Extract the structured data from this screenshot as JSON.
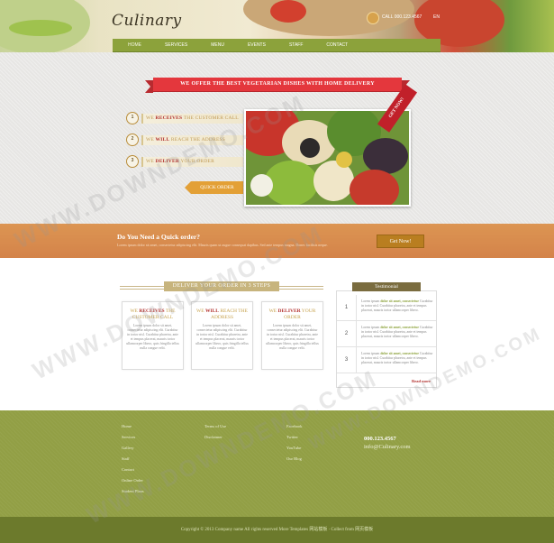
{
  "header": {
    "logo": "Culinary",
    "phone": "CALL 000.123.4567",
    "lang": "EN",
    "nav": [
      "HOME",
      "SERVICES",
      "MENU",
      "EVENTS",
      "STAFF",
      "CONTACT"
    ]
  },
  "hero": {
    "ribbon": "WE OFFER THE BEST VEGETARIAN DISHES WITH HOME DELIVERY",
    "steps": [
      {
        "num": "1",
        "pre": "WE ",
        "em": "RECEIVES",
        "post": " THE CUSTOMER CALL"
      },
      {
        "num": "2",
        "pre": "WE ",
        "em": "WILL",
        "post": " REACH THE ADDRESS"
      },
      {
        "num": "3",
        "pre": "WE ",
        "em": "DELIVER",
        "post": " YOUR ORDER"
      }
    ],
    "quick_order": "QUICK ORDER",
    "badge": "GET NOW!"
  },
  "band": {
    "title": "Do You Need a Quick order?",
    "subtitle": "Lorem ipsum dolor sit amet, consectetur adipiscing elit. Mauris quam ut augue consequat dapibus. Sed ante tempus magna. Donec facilisis neque.",
    "button": "Get Now!"
  },
  "deliver": {
    "title": "DELIVER YOUR ORDER IN 3 STEPS",
    "cards": [
      {
        "pre": "WE ",
        "em": "RECEIVES",
        "post": " THE CUSTOMER CALL",
        "body": "Lorem ipsum dolor sit amet, consectetur adipiscing elit. Curabitur in tortor nisl. Curabitur pharetra, ante et tempus placerat, mauris tortor ullamcorper libero, quis fringilla tellus nulla congue velit."
      },
      {
        "pre": "WE ",
        "em": "WILL",
        "post": " REACH THE ADDRESS",
        "body": "Lorem ipsum dolor sit amet, consectetur adipiscing elit. Curabitur in tortor nisl. Curabitur pharetra, ante et tempus placerat, mauris tortor ullamcorper libero, quis fringilla tellus nulla congue velit."
      },
      {
        "pre": "WE ",
        "em": "DELIVER",
        "post": " YOUR ORDER",
        "body": "Lorem ipsum dolor sit amet, consectetur adipiscing elit. Curabitur in tortor nisl. Curabitur pharetra, ante et tempus placerat, mauris tortor ullamcorper libero, quis fringilla tellus nulla congue velit."
      }
    ]
  },
  "testimonial": {
    "title": "Testimonial",
    "rows": [
      {
        "num": "1",
        "lead": "Lorem ipsum ",
        "em": "dolor sit amet, consectetur",
        "rest": " Curabitur in tortor nisl. Curabitur pharetra, ante et tempus placerat, mauris tortor ullamcorper libero."
      },
      {
        "num": "2",
        "lead": "Lorem ipsum ",
        "em": "dolor sit amet, consectetur",
        "rest": " Curabitur in tortor nisl. Curabitur pharetra, ante et tempus placerat, mauris tortor ullamcorper libero."
      },
      {
        "num": "3",
        "lead": "Lorem ipsum ",
        "em": "dolor sit amet, consectetur",
        "rest": " Curabitur in tortor nisl. Curabitur pharetra, ante et tempus placerat, mauris tortor ullamcorper libero."
      }
    ],
    "read_more": "Read more"
  },
  "footer": {
    "col1": [
      "Home",
      "Services",
      "Gallery",
      "Staff",
      "Contact",
      "Online Order",
      "Student Plans"
    ],
    "col2": [
      "Terms of Use",
      "Disclaimer"
    ],
    "col3": [
      "Facebook",
      "Twitter",
      "YouTube",
      "Our Blog"
    ],
    "phone": "000.123.4567",
    "email": "info@Culinary.com",
    "copyright": "Copyright © 2013 Company name All rights reserved More Templates 网站模板 · Collect from 网页模板"
  },
  "watermark": "WWW.DOWNDEMO.COM",
  "colors": {
    "nav": "#8ca23b",
    "ribbon": "#e4373d",
    "band": "#d4834a",
    "footer": "#929f45",
    "accent_red": "#b3302d"
  }
}
